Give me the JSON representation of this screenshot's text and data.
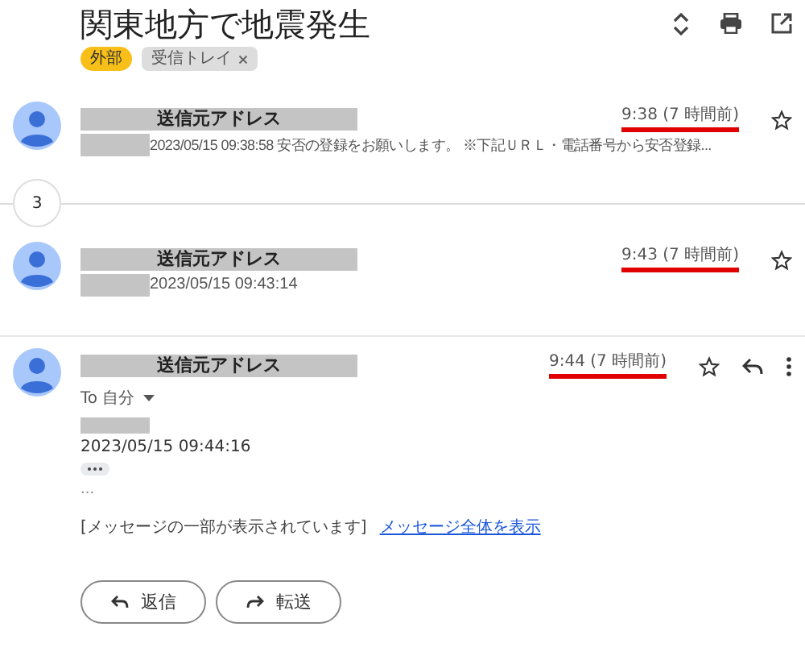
{
  "subject": "関東地方で地震発生",
  "labels": [
    {
      "text": "外部",
      "kind": "external"
    },
    {
      "text": "受信トレイ",
      "kind": "inbox",
      "removable": true
    }
  ],
  "hidden_count": "3",
  "messages": [
    {
      "kind": "collapsed",
      "sender": "送信元アドレス",
      "time": "9:38 (7 時間前)",
      "snippet": "2023/05/15 09:38:58 安否の登録をお願いします。 ※下記ＵＲＬ・電話番号から安否登録..."
    },
    {
      "kind": "collapsed",
      "sender": "送信元アドレス",
      "time": "9:43 (7 時間前)",
      "snippet": "2023/05/15 09:43:14"
    },
    {
      "kind": "expanded",
      "sender": "送信元アドレス",
      "time": "9:44 (7 時間前)",
      "to": "To 自分",
      "body_date": "2023/05/15 09:44:16",
      "ellipsis": "...",
      "clipped_note": "[メッセージの一部が表示されています]",
      "view_link": "メッセージ全体を表示"
    }
  ],
  "actions": [
    {
      "kind": "reply",
      "label": "返信"
    },
    {
      "kind": "forward",
      "label": "転送"
    }
  ]
}
